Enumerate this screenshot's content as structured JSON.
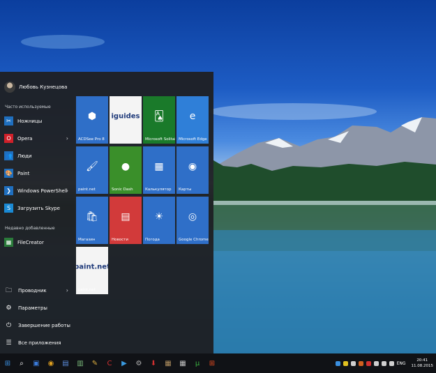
{
  "start_menu": {
    "user_name": "Любовь Кузнецова",
    "most_used_title": "Часто используемые",
    "most_used": [
      {
        "label": "Ножницы",
        "icon": "scissors-icon",
        "color": "#1f6fbf",
        "glyph": "✂",
        "has_arrow": false
      },
      {
        "label": "Opera",
        "icon": "opera-icon",
        "color": "#d0202a",
        "glyph": "O",
        "has_arrow": true
      },
      {
        "label": "Люди",
        "icon": "people-icon",
        "color": "#1f6fbf",
        "glyph": "👥",
        "has_arrow": false
      },
      {
        "label": "Paint",
        "icon": "paint-icon",
        "color": "#1f6fbf",
        "glyph": "🎨",
        "has_arrow": false
      },
      {
        "label": "Windows PowerShell",
        "icon": "powershell-icon",
        "color": "#1f6fbf",
        "glyph": "❯",
        "has_arrow": true
      },
      {
        "label": "Загрузить Skype",
        "icon": "skype-icon",
        "color": "#1a8ad4",
        "glyph": "S",
        "has_arrow": false
      }
    ],
    "recent_title": "Недавно добавленные",
    "recent": [
      {
        "label": "FileCreator",
        "icon": "filecreator-icon",
        "color": "#2a7a3a",
        "glyph": "▦"
      }
    ],
    "system": [
      {
        "label": "Проводник",
        "icon": "explorer-icon",
        "glyph": "🗀",
        "has_arrow": true
      },
      {
        "label": "Параметры",
        "icon": "settings-icon",
        "glyph": "⚙",
        "has_arrow": false
      },
      {
        "label": "Завершение работы",
        "icon": "power-icon",
        "glyph": "⏻",
        "has_arrow": false
      },
      {
        "label": "Все приложения",
        "icon": "all-apps-icon",
        "glyph": "☰",
        "has_arrow": false
      }
    ],
    "tiles": [
      {
        "label": "ACDSee Pro 8",
        "icon": "acdsee-icon",
        "color": "#2f6fc8",
        "glyph": "⬢"
      },
      {
        "label": "",
        "icon": "iguides-icon",
        "color": "#f4f4f4",
        "glyph": "iguides"
      },
      {
        "label": "Microsoft Solitaire Collection",
        "icon": "solitaire-icon",
        "color": "#1a7a2a",
        "glyph": "🂡"
      },
      {
        "label": "Microsoft Edge",
        "icon": "edge-icon",
        "color": "#2f7fd8",
        "glyph": "e"
      },
      {
        "label": "paint.net",
        "icon": "paintnet-icon",
        "color": "#2f6fc8",
        "glyph": "🖌"
      },
      {
        "label": "Sonic Dash",
        "icon": "sonic-icon",
        "color": "#3a8f2a",
        "glyph": "●"
      },
      {
        "label": "Калькулятор",
        "icon": "calculator-icon",
        "color": "#2f6fc8",
        "glyph": "▦"
      },
      {
        "label": "Карты",
        "icon": "maps-icon",
        "color": "#2f6fc8",
        "glyph": "◉"
      },
      {
        "label": "Магазин",
        "icon": "store-icon",
        "color": "#2f6fc8",
        "glyph": "🛍"
      },
      {
        "label": "Новости",
        "icon": "news-icon",
        "color": "#d23a3a",
        "glyph": "▤"
      },
      {
        "label": "Погода",
        "icon": "weather-icon",
        "color": "#2f6fc8",
        "glyph": "☀"
      },
      {
        "label": "Google Chrome",
        "icon": "chrome-icon",
        "color": "#2f6fc8",
        "glyph": "◎"
      },
      {
        "label": "paint.net",
        "icon": "paintnet-large-icon",
        "color": "#f4f4f4",
        "glyph": "paint.net"
      }
    ]
  },
  "taskbar": {
    "buttons": [
      {
        "icon": "start-icon",
        "glyph": "⊞",
        "color": "#3a8fe0"
      },
      {
        "icon": "search-icon",
        "glyph": "⌕",
        "color": "#ffffff"
      },
      {
        "icon": "save-icon",
        "glyph": "▣",
        "color": "#3a7ad8"
      },
      {
        "icon": "chrome-icon",
        "glyph": "◉",
        "color": "#e0a020"
      },
      {
        "icon": "paintnet-icon",
        "glyph": "▤",
        "color": "#5a8ad8"
      },
      {
        "icon": "notes-icon",
        "glyph": "▥",
        "color": "#7ab87a"
      },
      {
        "icon": "tool-icon",
        "glyph": "✎",
        "color": "#e0b040"
      },
      {
        "icon": "ccleaner-icon",
        "glyph": "C",
        "color": "#d03030"
      },
      {
        "icon": "player-icon",
        "glyph": "▶",
        "color": "#3a9ae0"
      },
      {
        "icon": "settings-icon",
        "glyph": "⚙",
        "color": "#b0b0b0"
      },
      {
        "icon": "downloader-icon",
        "glyph": "⬇",
        "color": "#d03030"
      },
      {
        "icon": "notepad-icon",
        "glyph": "▦",
        "color": "#b09060"
      },
      {
        "icon": "calculator-icon",
        "glyph": "▦",
        "color": "#c0c0c0"
      },
      {
        "icon": "utorrent-icon",
        "glyph": "µ",
        "color": "#3ab040"
      },
      {
        "icon": "windows-icon",
        "glyph": "⊞",
        "color": "#e04a20"
      }
    ],
    "tray_icons": [
      {
        "icon": "tray-app-1-icon",
        "color": "#3a8fe0"
      },
      {
        "icon": "tray-app-2-icon",
        "color": "#e0c020"
      },
      {
        "icon": "tray-app-3-icon",
        "color": "#cfcfcf"
      },
      {
        "icon": "tray-app-4-icon",
        "color": "#d06020"
      },
      {
        "icon": "tray-app-5-icon",
        "color": "#d03030"
      },
      {
        "icon": "tray-app-6-icon",
        "color": "#cfcfcf"
      },
      {
        "icon": "tray-app-7-icon",
        "color": "#cfcfcf"
      },
      {
        "icon": "tray-app-8-icon",
        "color": "#cfcfcf"
      }
    ],
    "language": "ENG",
    "time": "20:41",
    "date": "11.08.2015"
  }
}
